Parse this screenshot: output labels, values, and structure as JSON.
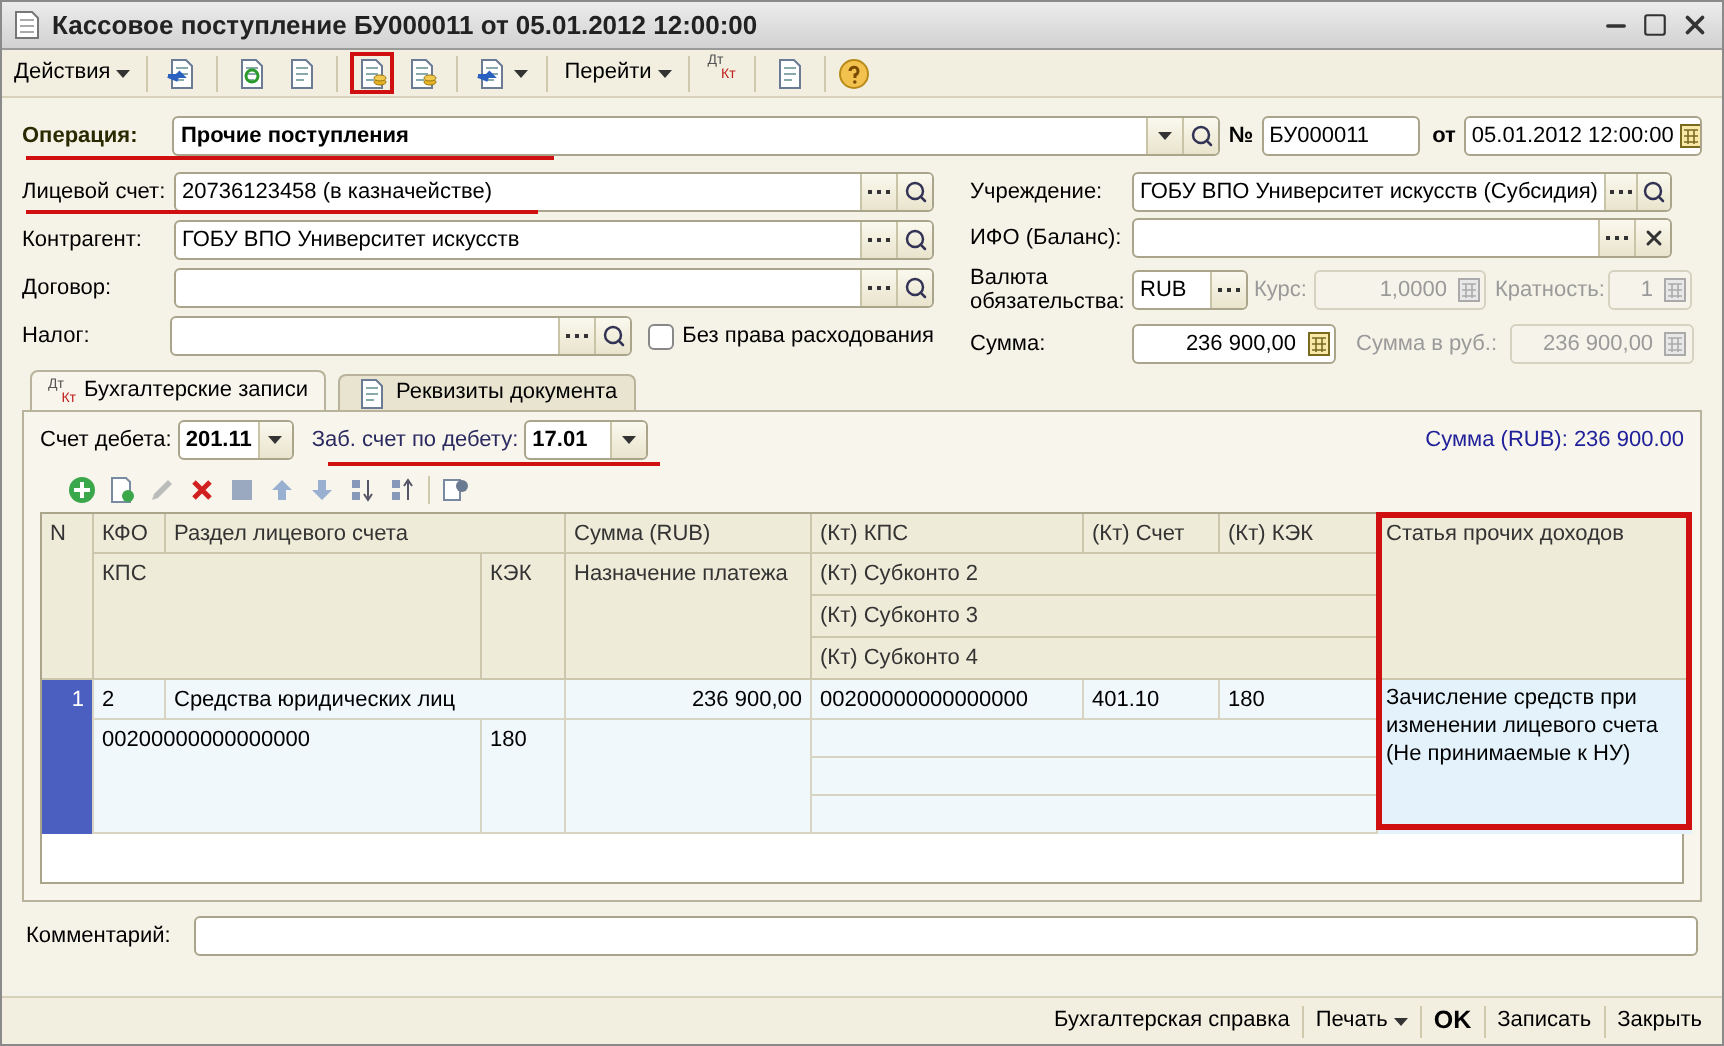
{
  "window": {
    "title": "Кассовое поступление БУ000011 от 05.01.2012 12:00:00"
  },
  "toolbar": {
    "actions": "Действия",
    "goto": "Перейти",
    "ledger_icon": {
      "top": "Дт",
      "bottom": "Кт"
    }
  },
  "operation": {
    "label": "Операция:",
    "value": "Прочие поступления"
  },
  "number": {
    "label": "№",
    "value": "БУ000011"
  },
  "date": {
    "label": "от",
    "value": "05.01.2012 12:00:00"
  },
  "left_fields": [
    {
      "label": "Лицевой счет:",
      "value": "20736123458 (в казначействе)"
    },
    {
      "label": "Контрагент:",
      "value": "ГОБУ ВПО Университет искусств"
    },
    {
      "label": "Договор:"
    },
    {
      "label": "Налог:"
    }
  ],
  "no_spending_right": {
    "label": "Без права расходования",
    "checked": false
  },
  "institution": {
    "label": "Учреждение:",
    "value": "ГОБУ ВПО Университет искусств (Субсидия)"
  },
  "ifo": {
    "label": "ИФО (Баланс):"
  },
  "currency": {
    "label": "Валюта обязательства:",
    "value": "RUB"
  },
  "rate": {
    "label": "Курс:",
    "value": "1,0000",
    "disabled": true
  },
  "multiplicity": {
    "label": "Кратность:",
    "value": "1",
    "disabled": true
  },
  "amount": {
    "label": "Сумма:",
    "value": "236 900,00",
    "disabled": false
  },
  "amount_rub": {
    "label": "Сумма в руб.:",
    "value": "236 900,00",
    "disabled": true
  },
  "tabs": [
    {
      "label": "Бухгалтерские записи",
      "kind": "ledger",
      "icon_top": "Дт",
      "icon_bottom": "Кт",
      "selected": true
    },
    {
      "label": "Реквизиты документа",
      "kind": "document",
      "selected": false
    }
  ],
  "debit_account": {
    "label": "Счет дебета:",
    "value": "201.11"
  },
  "offbalance_debit": {
    "label": "Заб. счет по дебету:",
    "value": "17.01"
  },
  "total": "Сумма (RUB): 236 900.00",
  "table": {
    "header": {
      "n": "N",
      "kfo": "КФО",
      "section": "Раздел лицевого счета",
      "sum": "Сумма (RUB)",
      "kt_kps": "(Кт) КПС",
      "kt_account": "(Кт) Счет",
      "kt_kek": "(Кт) КЭК",
      "other_income_article": "Статья прочих доходов",
      "kps": "КПС",
      "kek": "КЭК",
      "payment_purpose": "Назначение платежа",
      "kt_subconto_2": "(Кт) Субконто 2",
      "kt_subconto_3": "(Кт) Субконто 3",
      "kt_subconto_4": "(Кт) Субконто 4"
    },
    "rows": [
      {
        "n": "1",
        "selected": true,
        "kfo": "2",
        "section": "Средства юридических лиц",
        "sum": "236 900,00",
        "kt_kps": "00200000000000000",
        "kt_account": "401.10",
        "kt_kek": "180",
        "kps": "00200000000000000",
        "kek": "180",
        "other_income_article": "Зачисление средств при изменении лицевого счета (Не принимаемые к НУ)"
      }
    ]
  },
  "comment": {
    "label": "Комментарий:"
  },
  "footer_buttons": [
    {
      "label": "Бухгалтерская справка",
      "kind": "plain"
    },
    {
      "label": "Печать",
      "kind": "menu"
    },
    {
      "label": "OK",
      "kind": "bold"
    },
    {
      "label": "Записать",
      "kind": "plain"
    },
    {
      "label": "Закрыть",
      "kind": "plain"
    }
  ]
}
